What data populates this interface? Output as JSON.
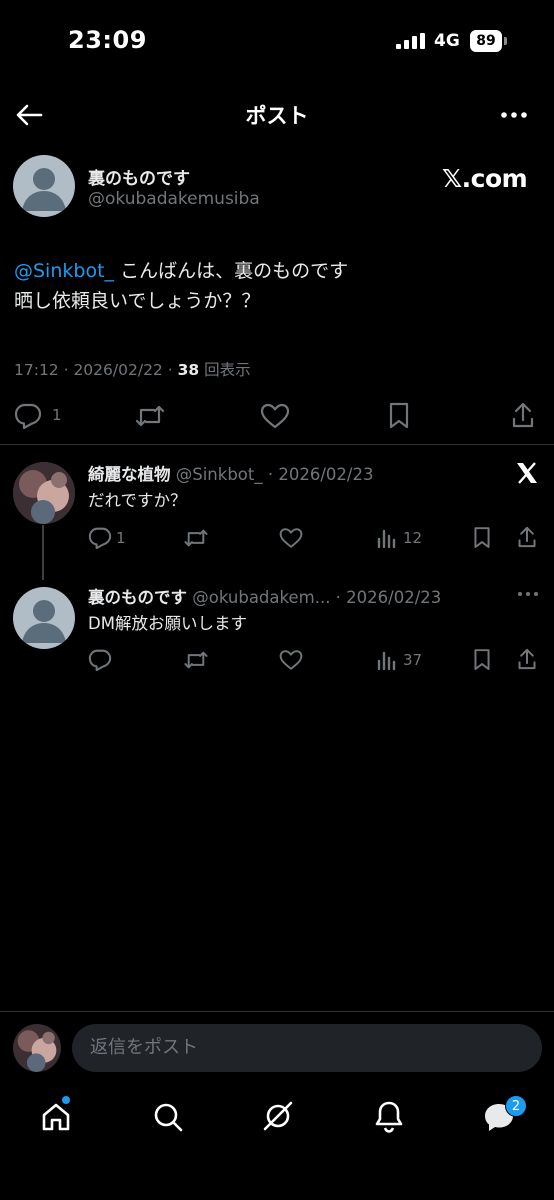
{
  "status_bar": {
    "time": "23:09",
    "network": "4G",
    "battery": "89"
  },
  "header": {
    "title": "ポスト"
  },
  "post": {
    "author_name": "裏のものです",
    "author_handle": "@okubadakemusiba",
    "source_label": "𝕏.com",
    "mention": "@Sinkbot_",
    "text_line1": " こんばんは、裏のものです",
    "text_line2": "晒し依頼良いでしょうか？？",
    "timestamp": "17:12 · 2026/02/22 · ",
    "views_count": "38",
    "views_label": " 回表示",
    "reply_count": "1"
  },
  "replies": [
    {
      "name": "綺麗な植物",
      "handle_date": " @Sinkbot_ · 2026/02/23",
      "text": "だれですか？",
      "reply_count": "1",
      "views": "12"
    },
    {
      "name": "裏のものです",
      "handle_date": " @okubadakem... · 2026/02/23",
      "text": "DM解放お願いします",
      "reply_count": "",
      "views": "37"
    }
  ],
  "compose": {
    "placeholder": "返信をポスト"
  },
  "nav": {
    "messages_badge": "2"
  },
  "colors": {
    "accent": "#1d9bf0",
    "muted": "#71767b",
    "background": "#000000"
  },
  "icons": [
    "back-arrow-icon",
    "more-icon",
    "reply-icon",
    "retweet-icon",
    "like-icon",
    "bookmark-icon",
    "share-icon",
    "views-icon",
    "home-icon",
    "search-icon",
    "grok-icon",
    "bell-icon",
    "messages-icon",
    "x-logo-icon"
  ]
}
